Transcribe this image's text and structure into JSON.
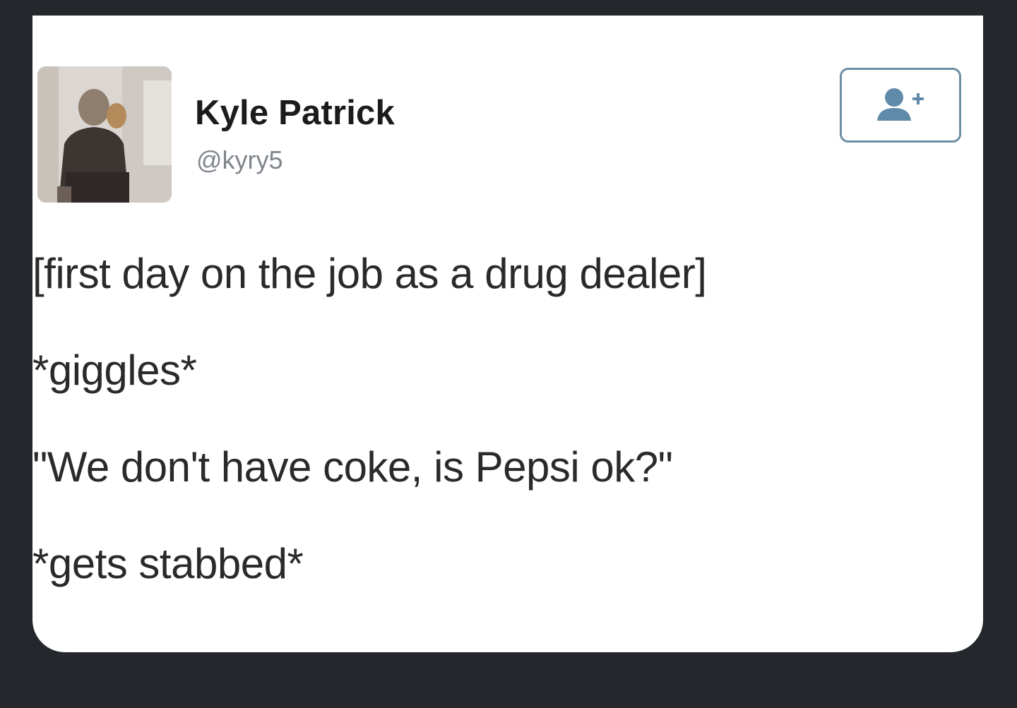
{
  "tweet": {
    "user": {
      "name": "Kyle Patrick",
      "handle": "@kyry5"
    },
    "follow_icon": "follow-person-plus-icon",
    "lines": [
      "[first day on the job as a drug dealer]",
      "*giggles*",
      "\"We don't have coke, is Pepsi ok?\"",
      "*gets stabbed*"
    ]
  },
  "colors": {
    "background": "#24272b",
    "card": "#ffffff",
    "name_text": "#1b1b1b",
    "handle_text": "#7f858c",
    "follow_accent": "#6c8ea5",
    "body_text": "#2a2a2a"
  }
}
